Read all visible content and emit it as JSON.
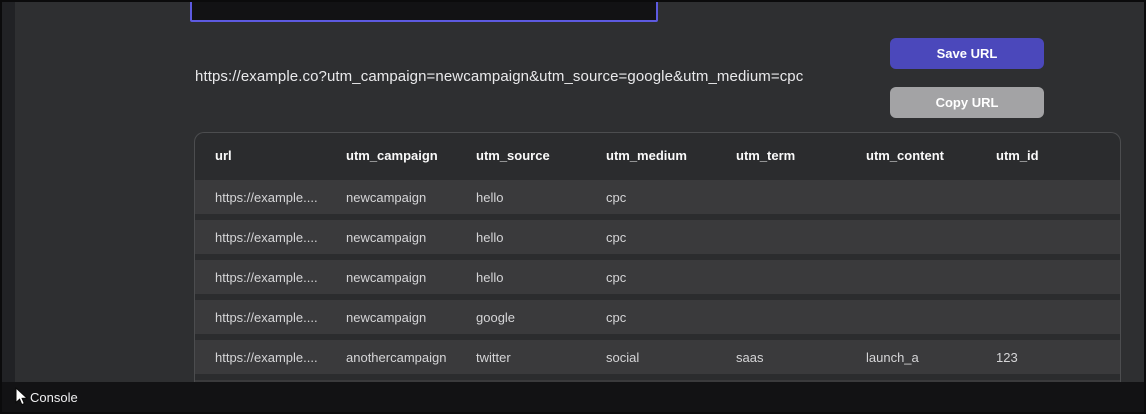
{
  "colors": {
    "page_background": "#2e2f31",
    "left_strip": "#212225",
    "input_border_accent": "#5d5ae0",
    "input_background": "#121214",
    "save_button": "#4b48bb",
    "copy_button": "#a3a3a5",
    "table_background": "#2b2c2e",
    "table_border": "#4c4d4f",
    "row_band": "#3a3a3c",
    "console_background": "#121214"
  },
  "url_input": {
    "value": "",
    "placeholder": ""
  },
  "url_display": {
    "text": "https://example.co?utm_campaign=newcampaign&utm_source=google&utm_medium=cpc"
  },
  "toolbar": {
    "save_label": "Save URL",
    "copy_label": "Copy URL"
  },
  "table": {
    "columns": [
      "url",
      "utm_campaign",
      "utm_source",
      "utm_medium",
      "utm_term",
      "utm_content",
      "utm_id"
    ],
    "rows": [
      {
        "cells": [
          "https://example....",
          "newcampaign",
          "hello",
          "cpc",
          "",
          "",
          ""
        ]
      },
      {
        "cells": [
          "https://example....",
          "newcampaign",
          "hello",
          "cpc",
          "",
          "",
          ""
        ]
      },
      {
        "cells": [
          "https://example....",
          "newcampaign",
          "hello",
          "cpc",
          "",
          "",
          ""
        ]
      },
      {
        "cells": [
          "https://example....",
          "newcampaign",
          "google",
          "cpc",
          "",
          "",
          ""
        ]
      },
      {
        "cells": [
          "https://example....",
          "anothercampaign",
          "twitter",
          "social",
          "saas",
          "launch_a",
          "123"
        ]
      },
      {
        "cells": [
          "",
          "",
          "",
          "",
          "",
          "",
          ""
        ],
        "partial": true
      }
    ]
  },
  "console": {
    "label": "Console"
  },
  "icons": {
    "cursor": "arrow-cursor-icon"
  }
}
